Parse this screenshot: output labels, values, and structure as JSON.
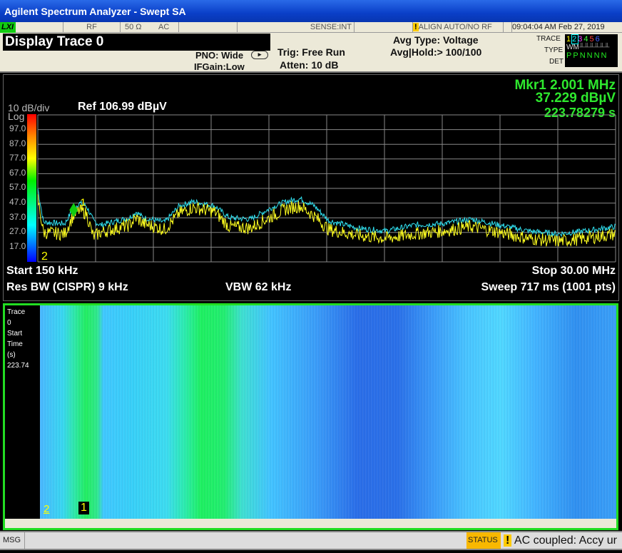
{
  "window": {
    "title": "Agilent Spectrum Analyzer - Swept SA"
  },
  "status_row": {
    "lxi": "LXI",
    "rf": "RF",
    "impedance": "50 Ω",
    "coupling": "AC",
    "sense": "SENSE:INT",
    "align": "ALIGN AUTO/NO RF",
    "datetime": "09:04:04 AM Feb 27, 2019"
  },
  "header": {
    "title": "Display Trace 0",
    "pno": "PNO: Wide",
    "ifgain": "IFGain:Low",
    "trig": "Trig: Free Run",
    "atten": "Atten: 10 dB",
    "avg_type": "Avg Type: Voltage",
    "avg_hold": "Avg|Hold:> 100/100",
    "trace_label": "TRACE",
    "type_label": "TYPE",
    "det_label": "DET",
    "traces": [
      "1",
      "2",
      "3",
      "4",
      "5",
      "6"
    ],
    "trace_colors": [
      "#ffff00",
      "#00ffff",
      "#ff40ff",
      "#40ff40",
      "#ff4040",
      "#4060ff"
    ],
    "type_value": "WM",
    "det_values": [
      "P",
      "P",
      "N",
      "N",
      "N",
      "N"
    ]
  },
  "display": {
    "scale": "10 dB/div",
    "log": "Log",
    "ref": "Ref 106.99 dBµV",
    "marker": {
      "line1": "Mkr1 2.001 MHz",
      "line2": "37.229 dBµV",
      "line3": "223.78279 s",
      "label": "1",
      "freq_mhz": 2.001,
      "level_dbuv": 37.229
    },
    "y_ticks": [
      "97.0",
      "87.0",
      "77.0",
      "67.0",
      "57.0",
      "47.0",
      "37.0",
      "27.0",
      "17.0"
    ],
    "trace2_label": "2",
    "start": "Start 150 kHz",
    "stop": "Stop 30.00 MHz",
    "rbw": "Res BW (CISPR)  9 kHz",
    "vbw": "VBW 62 kHz",
    "sweep": "Sweep  717 ms (1001 pts)"
  },
  "chart_data": {
    "type": "line",
    "x_unit": "MHz",
    "y_unit": "dBµV",
    "xlim": [
      0.15,
      30
    ],
    "ylim": [
      3,
      106.99
    ],
    "grid": true,
    "x": [
      0.15,
      0.44,
      1.55,
      1.92,
      2.29,
      2.66,
      3.02,
      3.39,
      4.87,
      5.24,
      5.6,
      6.71,
      7.45,
      8.18,
      9.29,
      10.03,
      11.13,
      12.24,
      12.97,
      13.71,
      14.45,
      15.18,
      16.66,
      18.13,
      19.61,
      21.08,
      22.55,
      24.03,
      25.5,
      26.98,
      28.45,
      30
    ],
    "series": [
      {
        "color": "#30e0f0",
        "values": [
          57,
          34,
          33,
          42,
          47,
          45,
          35,
          32,
          37,
          41,
          37,
          34,
          45,
          48,
          45,
          37,
          36,
          44,
          48,
          50,
          45,
          35,
          30,
          28,
          32,
          33,
          36,
          32,
          28,
          26,
          28,
          31
        ]
      },
      {
        "color": "#ffff20",
        "values": [
          50,
          27,
          26,
          37,
          42,
          40,
          24,
          27,
          32,
          37,
          33,
          29,
          40,
          44,
          41,
          31,
          30,
          38,
          43,
          45,
          38,
          29,
          25,
          23,
          26,
          28,
          31,
          27,
          23,
          21,
          23,
          26
        ]
      }
    ]
  },
  "spectrogram": {
    "side_lines": [
      "Trace",
      "0",
      "Start",
      "Time",
      "(s)",
      "223.74"
    ],
    "marker1": "1",
    "marker2": "2"
  },
  "msgbar": {
    "msg": "MSG",
    "status": "STATUS",
    "message": "AC coupled: Accy ur"
  }
}
